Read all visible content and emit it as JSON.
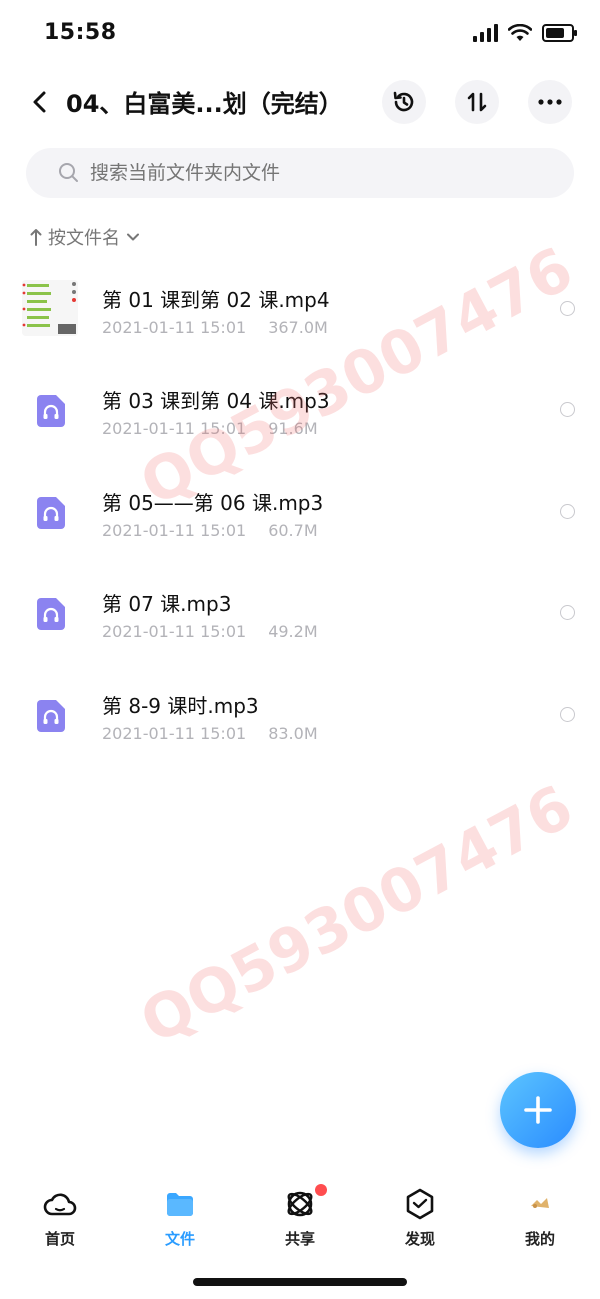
{
  "status_bar": {
    "time": "15:58"
  },
  "header": {
    "title": "04、白富美...划（完结）"
  },
  "search": {
    "placeholder": "搜索当前文件夹内文件"
  },
  "sort": {
    "label": "按文件名"
  },
  "files": [
    {
      "name": "第 01 课到第 02 课.mp4",
      "date": "2021-01-11 15:01",
      "size": "367.0M",
      "kind": "video"
    },
    {
      "name": "第 03 课到第 04 课.mp3",
      "date": "2021-01-11 15:01",
      "size": "91.6M",
      "kind": "audio"
    },
    {
      "name": "第 05——第 06 课.mp3",
      "date": "2021-01-11 15:01",
      "size": "60.7M",
      "kind": "audio"
    },
    {
      "name": "第 07 课.mp3",
      "date": "2021-01-11 15:01",
      "size": "49.2M",
      "kind": "audio"
    },
    {
      "name": "第 8-9 课时.mp3",
      "date": "2021-01-11 15:01",
      "size": "83.0M",
      "kind": "audio"
    }
  ],
  "watermark": {
    "text": "QQ593007476"
  },
  "tabs": [
    {
      "label": "首页",
      "icon": "cloud-icon",
      "active": false
    },
    {
      "label": "文件",
      "icon": "folder-icon",
      "active": true
    },
    {
      "label": "共享",
      "icon": "share-orbit-icon",
      "active": false,
      "badge": true
    },
    {
      "label": "发现",
      "icon": "discover-icon",
      "active": false
    },
    {
      "label": "我的",
      "icon": "avatar-icon",
      "active": false
    }
  ],
  "colors": {
    "accent": "#2a9cff",
    "audio_icon": "#8b83f0",
    "badge": "#ff4d4f"
  }
}
